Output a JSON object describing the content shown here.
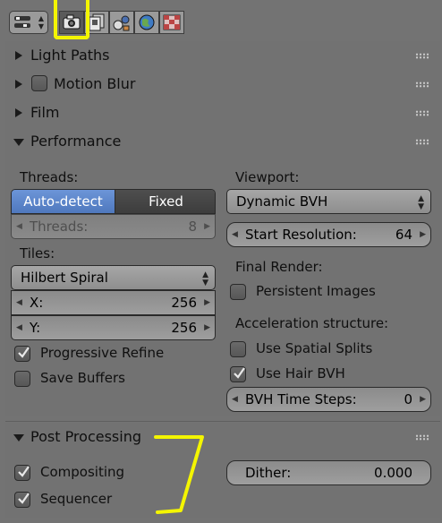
{
  "header": {
    "icons": [
      "render-layers-icon",
      "camera-icon",
      "layers-icon",
      "scene-icon",
      "world-icon",
      "texture-icon"
    ],
    "active_tab": "camera-icon"
  },
  "panels": {
    "light_paths": "Light Paths",
    "motion_blur": "Motion Blur",
    "film": "Film",
    "performance": "Performance",
    "post_processing": "Post Processing"
  },
  "performance": {
    "threads_label": "Threads:",
    "threads_modes": [
      "Auto-detect",
      "Fixed"
    ],
    "threads_field_label": "Threads:",
    "threads_field_value": "8",
    "tiles_label": "Tiles:",
    "tiles_order": "Hilbert Spiral",
    "tile_x_label": "X:",
    "tile_x_value": "256",
    "tile_y_label": "Y:",
    "tile_y_value": "256",
    "progressive_refine": "Progressive Refine",
    "save_buffers": "Save Buffers",
    "viewport_label": "Viewport:",
    "viewport_bvh": "Dynamic BVH",
    "start_res_label": "Start Resolution:",
    "start_res_value": "64",
    "final_render_label": "Final Render:",
    "persistent_images": "Persistent Images",
    "accel_label": "Acceleration structure:",
    "spatial_splits": "Use Spatial Splits",
    "hair_bvh": "Use Hair BVH",
    "bvh_steps_label": "BVH Time Steps:",
    "bvh_steps_value": "0"
  },
  "post_processing": {
    "compositing": "Compositing",
    "sequencer": "Sequencer",
    "dither_label": "Dither:",
    "dither_value": "0.000"
  },
  "colors": {
    "accent": "#5680c2",
    "annotation": "#f4f500"
  }
}
